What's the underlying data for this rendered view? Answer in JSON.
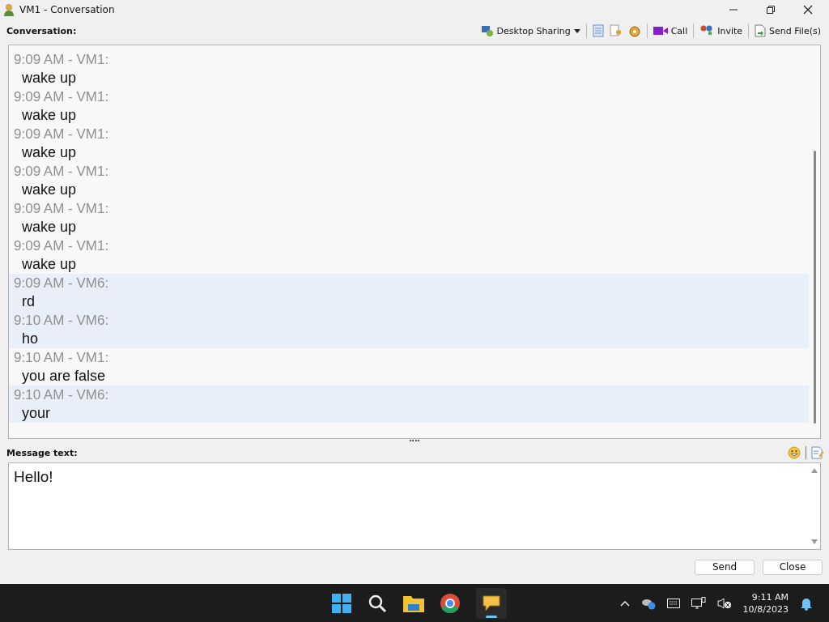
{
  "window": {
    "title": "VM1 - Conversation"
  },
  "conversation_label": "Conversation:",
  "toolbar": [
    {
      "kind": "dropdown",
      "label": "Desktop Sharing"
    },
    {
      "kind": "sep"
    },
    {
      "kind": "icon"
    },
    {
      "kind": "icon"
    },
    {
      "kind": "icon"
    },
    {
      "kind": "sep"
    },
    {
      "kind": "button",
      "label": "Call"
    },
    {
      "kind": "sep"
    },
    {
      "kind": "button",
      "label": "Invite"
    },
    {
      "kind": "sep"
    },
    {
      "kind": "button",
      "label": "Send File(s)"
    }
  ],
  "messages": [
    {
      "header": "9:09 AM - VM1:",
      "text": "wake up",
      "kind": "local"
    },
    {
      "header": "9:09 AM - VM1:",
      "text": "wake up",
      "kind": "local"
    },
    {
      "header": "9:09 AM - VM1:",
      "text": "wake up",
      "kind": "local"
    },
    {
      "header": "9:09 AM - VM1:",
      "text": "wake up",
      "kind": "local"
    },
    {
      "header": "9:09 AM - VM1:",
      "text": "wake up",
      "kind": "local"
    },
    {
      "header": "9:09 AM - VM1:",
      "text": "wake up",
      "kind": "local"
    },
    {
      "header": "9:09 AM - VM6:",
      "text": "rd",
      "kind": "remote"
    },
    {
      "header": "9:10 AM - VM6:",
      "text": "ho",
      "kind": "remote"
    },
    {
      "header": "9:10 AM - VM1:",
      "text": "you are false",
      "kind": "local"
    },
    {
      "header": "9:10 AM - VM6:",
      "text": "your",
      "kind": "remote"
    }
  ],
  "message_label": "Message text:",
  "message_input": {
    "value": "Hello!"
  },
  "buttons": [
    "Send",
    "Close"
  ],
  "taskbar": {
    "time": "9:11 AM",
    "date": "10/8/2023"
  }
}
